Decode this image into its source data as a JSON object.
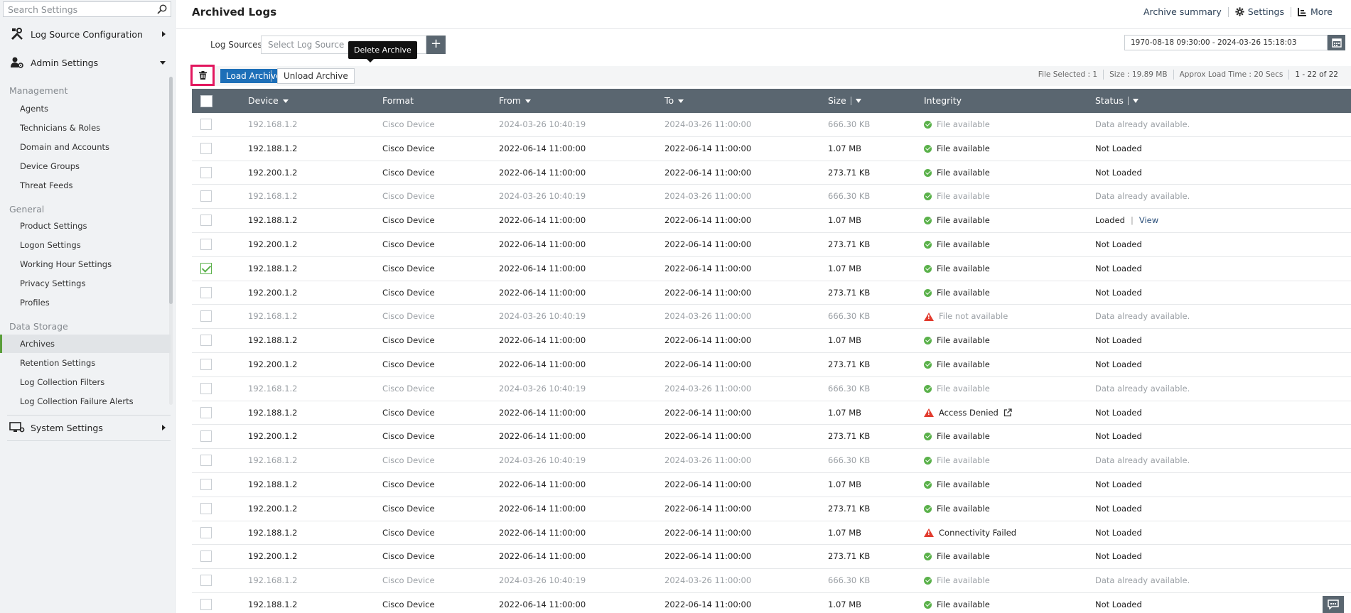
{
  "sidebar": {
    "search_placeholder": "Search Settings",
    "log_source_config": "Log Source Configuration",
    "admin_settings": "Admin Settings",
    "system_settings": "System Settings",
    "sections": {
      "management": "Management",
      "general": "General",
      "data_storage": "Data Storage"
    },
    "management_items": [
      "Agents",
      "Technicians & Roles",
      "Domain and Accounts",
      "Device Groups",
      "Threat Feeds"
    ],
    "general_items": [
      "Product Settings",
      "Logon Settings",
      "Working Hour Settings",
      "Privacy Settings",
      "Profiles"
    ],
    "data_storage_items": [
      "Archives",
      "Retention Settings",
      "Log Collection Filters",
      "Log Collection Failure Alerts"
    ],
    "active_item": "Archives"
  },
  "header": {
    "title": "Archived Logs",
    "archive_summary": "Archive summary",
    "settings": "Settings",
    "more": "More"
  },
  "filters": {
    "log_sources_label": "Log Sources",
    "log_source_placeholder": "Select Log Source",
    "add_symbol": "+",
    "date_range": "1970-08-18 09:30:00 - 2024-03-26 15:18:03"
  },
  "toolbar": {
    "delete_tooltip": "Delete Archive",
    "load_archive": "Load Archive",
    "unload_archive": "Unload Archive",
    "file_selected": "File Selected : 1",
    "size": "Size : 19.89 MB",
    "approx_load_time": "Approx Load Time : 20 Secs",
    "pagination": "1 - 22 of 22"
  },
  "table": {
    "columns": {
      "device": "Device",
      "format": "Format",
      "from": "From",
      "to": "To",
      "size": "Size",
      "integrity": "Integrity",
      "status": "Status"
    },
    "rows": [
      {
        "device": "192.168.1.2",
        "format": "Cisco Device",
        "from": "2024-03-26 10:40:19",
        "to": "2024-03-26 11:00:00",
        "size": "666.30 KB",
        "integrity": "File available",
        "integrity_state": "ok",
        "status": "Data already available.",
        "checked": false,
        "dim": true
      },
      {
        "device": "192.188.1.2",
        "format": "Cisco Device",
        "from": "2022-06-14 11:00:00",
        "to": "2022-06-14 11:00:00",
        "size": "1.07 MB",
        "integrity": "File available",
        "integrity_state": "ok",
        "status": "Not Loaded",
        "checked": false,
        "dim": false
      },
      {
        "device": "192.200.1.2",
        "format": "Cisco Device",
        "from": "2022-06-14 11:00:00",
        "to": "2022-06-14 11:00:00",
        "size": "273.71 KB",
        "integrity": "File available",
        "integrity_state": "ok",
        "status": "Not Loaded",
        "checked": false,
        "dim": false
      },
      {
        "device": "192.168.1.2",
        "format": "Cisco Device",
        "from": "2024-03-26 10:40:19",
        "to": "2024-03-26 11:00:00",
        "size": "666.30 KB",
        "integrity": "File available",
        "integrity_state": "ok",
        "status": "Data already available.",
        "checked": false,
        "dim": true
      },
      {
        "device": "192.188.1.2",
        "format": "Cisco Device",
        "from": "2022-06-14 11:00:00",
        "to": "2022-06-14 11:00:00",
        "size": "1.07 MB",
        "integrity": "File available",
        "integrity_state": "ok",
        "status": "Loaded",
        "view": "View",
        "checked": false,
        "dim": false
      },
      {
        "device": "192.200.1.2",
        "format": "Cisco Device",
        "from": "2022-06-14 11:00:00",
        "to": "2022-06-14 11:00:00",
        "size": "273.71 KB",
        "integrity": "File available",
        "integrity_state": "ok",
        "status": "Not Loaded",
        "checked": false,
        "dim": false
      },
      {
        "device": "192.188.1.2",
        "format": "Cisco Device",
        "from": "2022-06-14 11:00:00",
        "to": "2022-06-14 11:00:00",
        "size": "1.07 MB",
        "integrity": "File available",
        "integrity_state": "ok",
        "status": "Not Loaded",
        "checked": true,
        "dim": false
      },
      {
        "device": "192.200.1.2",
        "format": "Cisco Device",
        "from": "2022-06-14 11:00:00",
        "to": "2022-06-14 11:00:00",
        "size": "273.71 KB",
        "integrity": "File available",
        "integrity_state": "ok",
        "status": "Not Loaded",
        "checked": false,
        "dim": false
      },
      {
        "device": "192.168.1.2",
        "format": "Cisco Device",
        "from": "2024-03-26 10:40:19",
        "to": "2024-03-26 11:00:00",
        "size": "666.30 KB",
        "integrity": "File not available",
        "integrity_state": "warn",
        "status": "Data already available.",
        "checked": false,
        "dim": true
      },
      {
        "device": "192.188.1.2",
        "format": "Cisco Device",
        "from": "2022-06-14 11:00:00",
        "to": "2022-06-14 11:00:00",
        "size": "1.07 MB",
        "integrity": "File available",
        "integrity_state": "ok",
        "status": "Not Loaded",
        "checked": false,
        "dim": false
      },
      {
        "device": "192.200.1.2",
        "format": "Cisco Device",
        "from": "2022-06-14 11:00:00",
        "to": "2022-06-14 11:00:00",
        "size": "273.71 KB",
        "integrity": "File available",
        "integrity_state": "ok",
        "status": "Not Loaded",
        "checked": false,
        "dim": false
      },
      {
        "device": "192.168.1.2",
        "format": "Cisco Device",
        "from": "2024-03-26 10:40:19",
        "to": "2024-03-26 11:00:00",
        "size": "666.30 KB",
        "integrity": "File available",
        "integrity_state": "ok",
        "status": "Data already available.",
        "checked": false,
        "dim": true
      },
      {
        "device": "192.188.1.2",
        "format": "Cisco Device",
        "from": "2022-06-14 11:00:00",
        "to": "2022-06-14 11:00:00",
        "size": "1.07 MB",
        "integrity": "Access Denied",
        "integrity_state": "warn",
        "external_link": true,
        "status": "Not Loaded",
        "checked": false,
        "dim": false
      },
      {
        "device": "192.200.1.2",
        "format": "Cisco Device",
        "from": "2022-06-14 11:00:00",
        "to": "2022-06-14 11:00:00",
        "size": "273.71 KB",
        "integrity": "File available",
        "integrity_state": "ok",
        "status": "Not Loaded",
        "checked": false,
        "dim": false
      },
      {
        "device": "192.168.1.2",
        "format": "Cisco Device",
        "from": "2024-03-26 10:40:19",
        "to": "2024-03-26 11:00:00",
        "size": "666.30 KB",
        "integrity": "File available",
        "integrity_state": "ok",
        "status": "Data already available.",
        "checked": false,
        "dim": true
      },
      {
        "device": "192.188.1.2",
        "format": "Cisco Device",
        "from": "2022-06-14 11:00:00",
        "to": "2022-06-14 11:00:00",
        "size": "1.07 MB",
        "integrity": "File available",
        "integrity_state": "ok",
        "status": "Not Loaded",
        "checked": false,
        "dim": false
      },
      {
        "device": "192.200.1.2",
        "format": "Cisco Device",
        "from": "2022-06-14 11:00:00",
        "to": "2022-06-14 11:00:00",
        "size": "273.71 KB",
        "integrity": "File available",
        "integrity_state": "ok",
        "status": "Not Loaded",
        "checked": false,
        "dim": false
      },
      {
        "device": "192.188.1.2",
        "format": "Cisco Device",
        "from": "2022-06-14 11:00:00",
        "to": "2022-06-14 11:00:00",
        "size": "1.07 MB",
        "integrity": "Connectivity Failed",
        "integrity_state": "warn",
        "status": "Not Loaded",
        "checked": false,
        "dim": false
      },
      {
        "device": "192.200.1.2",
        "format": "Cisco Device",
        "from": "2022-06-14 11:00:00",
        "to": "2022-06-14 11:00:00",
        "size": "273.71 KB",
        "integrity": "File available",
        "integrity_state": "ok",
        "status": "Not Loaded",
        "checked": false,
        "dim": false
      },
      {
        "device": "192.168.1.2",
        "format": "Cisco Device",
        "from": "2024-03-26 10:40:19",
        "to": "2024-03-26 11:00:00",
        "size": "666.30 KB",
        "integrity": "File available",
        "integrity_state": "ok",
        "status": "Data already available.",
        "checked": false,
        "dim": true
      },
      {
        "device": "192.188.1.2",
        "format": "Cisco Device",
        "from": "2022-06-14 11:00:00",
        "to": "2022-06-14 11:00:00",
        "size": "1.07 MB",
        "integrity": "File available",
        "integrity_state": "ok",
        "status": "Not Loaded",
        "checked": false,
        "dim": false
      }
    ]
  },
  "colors": {
    "accent_green": "#5ab14a",
    "header_gray": "#5a6670",
    "primary_blue": "#1d6fb8",
    "warning_red": "#e23b2e",
    "highlight_pink": "#e2165e"
  }
}
